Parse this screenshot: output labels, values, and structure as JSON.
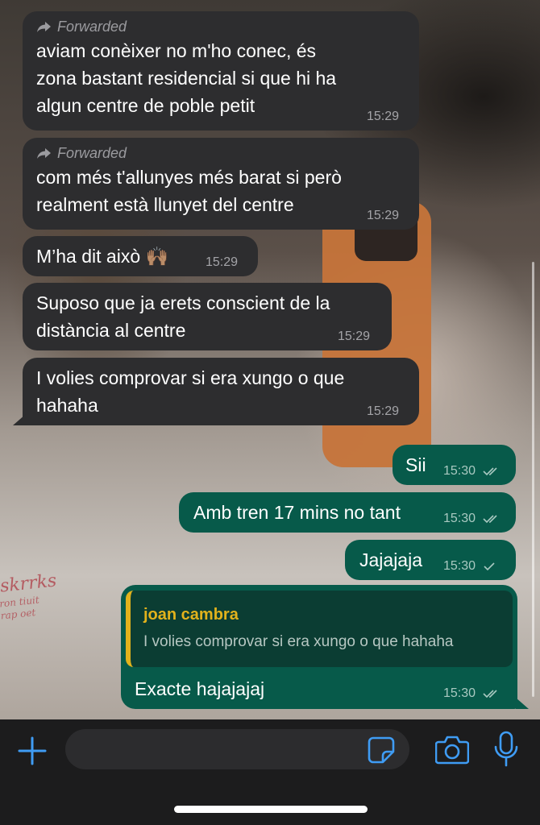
{
  "chat": {
    "forwarded_label": "Forwarded",
    "messages": [
      {
        "text_lines": [
          "aviam conèixer no m'ho conec, és",
          "zona bastant residencial si que hi ha",
          "algun centre de poble petit"
        ],
        "time": "15:29",
        "forwarded": true
      },
      {
        "text_lines": [
          "com més t'allunyes més barat si però",
          "realment està llunyet del centre"
        ],
        "time": "15:29",
        "forwarded": true
      },
      {
        "text_lines": [
          "M’ha dit això 🙌🏽"
        ],
        "time": "15:29"
      },
      {
        "text_lines": [
          "Suposo que ja erets conscient de la",
          "distància al centre"
        ],
        "time": "15:29"
      },
      {
        "text_lines": [
          "I volies comprovar si era xungo o que",
          "hahaha"
        ],
        "time": "15:29"
      },
      {
        "text_lines": [
          "Sii"
        ],
        "time": "15:30",
        "status": "read"
      },
      {
        "text_lines": [
          "Amb tren 17 mins no tant"
        ],
        "time": "15:30",
        "status": "read"
      },
      {
        "text_lines": [
          "Jajajaja"
        ],
        "time": "15:30",
        "status": "sent"
      },
      {
        "text_lines": [
          "Exacte hajajajaj"
        ],
        "time": "15:30",
        "status": "read",
        "reply": {
          "author": "joan cambra",
          "text": "I volies comprovar si era xungo o que hahaha"
        }
      }
    ]
  },
  "wallpaper": {
    "shirt_text": "skrrks",
    "shirt_sub_lines": [
      "ron tiuit",
      "rap oet"
    ]
  },
  "composer": {
    "placeholder": ""
  },
  "colors": {
    "incoming_bubble": "#2d2d2f",
    "outgoing_bubble": "#075a4a",
    "quote_accent": "#e2b21c",
    "icon_blue": "#3f9cf4"
  },
  "icons": {
    "add": "plus-icon",
    "sticker": "sticker-icon",
    "camera": "camera-icon",
    "mic": "microphone-icon",
    "forward": "forward-arrow-icon"
  }
}
